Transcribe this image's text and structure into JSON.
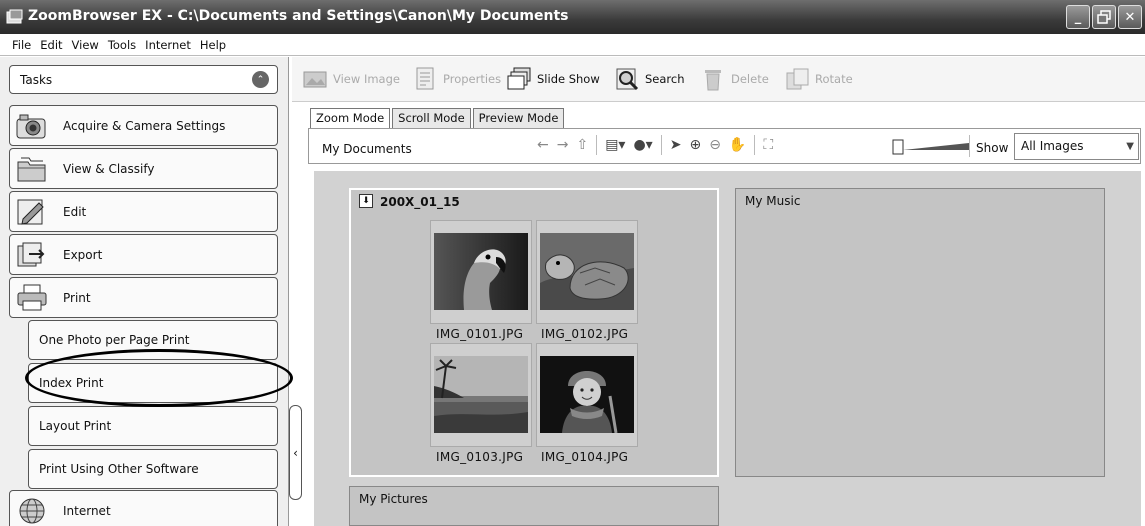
{
  "window": {
    "title": "ZoomBrowser EX  -  C:\\Documents and Settings\\Canon\\My Documents",
    "minimize_icon": "minimize-icon",
    "restore_icon": "restore-icon",
    "close_icon": "close-icon"
  },
  "menu": [
    "File",
    "Edit",
    "View",
    "Tools",
    "Internet",
    "Help"
  ],
  "tasks_panel": {
    "header": "Tasks",
    "items": [
      {
        "label": "Acquire & Camera Settings",
        "icon": "camera-icon"
      },
      {
        "label": "View & Classify",
        "icon": "folders-icon"
      },
      {
        "label": "Edit",
        "icon": "edit-icon"
      },
      {
        "label": "Export",
        "icon": "export-icon"
      },
      {
        "label": "Print",
        "icon": "printer-icon"
      },
      {
        "label": "Internet",
        "icon": "globe-icon"
      }
    ],
    "print_subitems": [
      "One Photo per Page Print",
      "Index Print",
      "Layout Print",
      "Print Using Other Software"
    ],
    "highlighted_subitem": "Index Print"
  },
  "toolbar": {
    "view_image": "View Image",
    "properties": "Properties",
    "slide_show": "Slide Show",
    "search": "Search",
    "delete": "Delete",
    "rotate": "Rotate"
  },
  "tabs": [
    "Zoom Mode",
    "Scroll Mode",
    "Preview Mode"
  ],
  "active_tab": "Zoom Mode",
  "navbar": {
    "path": "My Documents",
    "show_label": "Show",
    "show_value": "All Images"
  },
  "folders": {
    "selected": {
      "name": "200X_01_15"
    },
    "music": {
      "name": "My Music"
    },
    "pictures": {
      "name": "My Pictures"
    }
  },
  "thumbnails": [
    {
      "label": "IMG_0101.JPG",
      "subject": "parrot"
    },
    {
      "label": "IMG_0102.JPG",
      "subject": "tortoise"
    },
    {
      "label": "IMG_0103.JPG",
      "subject": "beach sunset"
    },
    {
      "label": "IMG_0104.JPG",
      "subject": "child in winter hat"
    }
  ]
}
